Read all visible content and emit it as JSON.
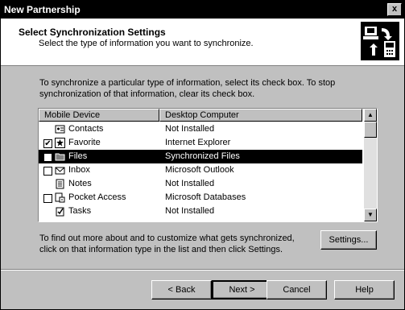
{
  "window": {
    "title": "New Partnership",
    "close_label": "x"
  },
  "header": {
    "title": "Select Synchronization Settings",
    "subtitle": "Select the type of information you want to synchronize.",
    "icon": "sync-devices-icon"
  },
  "instructions": "To synchronize a particular type of information, select its check box. To stop synchronization of that information, clear its check box.",
  "list": {
    "columns": [
      "Mobile Device",
      "Desktop Computer"
    ],
    "rows": [
      {
        "device": "Contacts",
        "desktop": "Not Installed",
        "checkbox": false,
        "checked": false,
        "icon": "contacts-icon"
      },
      {
        "device": "Favorite",
        "desktop": "Internet Explorer",
        "checkbox": true,
        "checked": true,
        "icon": "favorite-icon"
      },
      {
        "device": "Files",
        "desktop": "Synchronized Files",
        "checkbox": true,
        "checked": false,
        "icon": "files-icon",
        "selected": true
      },
      {
        "device": "Inbox",
        "desktop": "Microsoft Outlook",
        "checkbox": true,
        "checked": false,
        "icon": "inbox-icon"
      },
      {
        "device": "Notes",
        "desktop": "Not Installed",
        "checkbox": false,
        "checked": false,
        "icon": "notes-icon"
      },
      {
        "device": "Pocket Access",
        "desktop": "Microsoft Databases",
        "checkbox": true,
        "checked": false,
        "icon": "pocket-access-icon"
      },
      {
        "device": "Tasks",
        "desktop": "Not Installed",
        "checkbox": false,
        "checked": false,
        "icon": "tasks-icon"
      }
    ]
  },
  "info_text": "To find out more about and to customize what gets synchronized, click on that information type in the list and then click Settings.",
  "buttons": {
    "settings": "Settings...",
    "back": "< Back",
    "next": "Next >",
    "cancel": "Cancel",
    "help": "Help"
  },
  "colors": {
    "titlebar": "#000000",
    "face": "#c0c0c0",
    "selection": "#000000"
  }
}
